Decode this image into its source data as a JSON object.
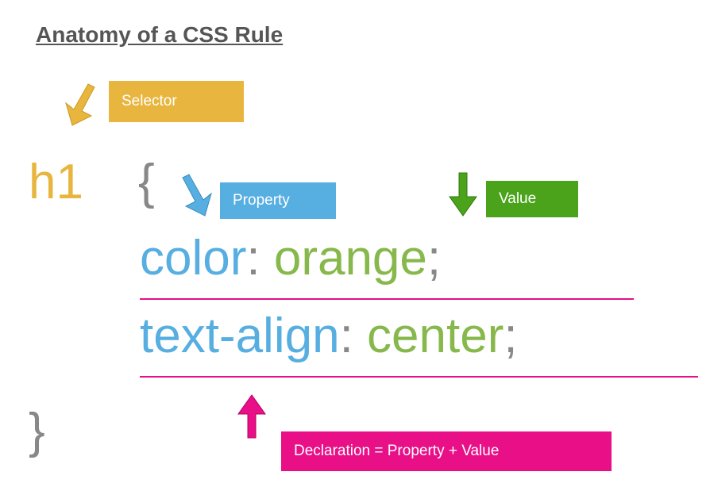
{
  "title": "Anatomy of a CSS Rule",
  "labels": {
    "selector": "Selector",
    "property": "Property",
    "value": "Value",
    "declaration": "Declaration = Property + Value"
  },
  "code": {
    "selector": "h1",
    "brace_open": "{",
    "brace_close": "}",
    "line1_property": "color",
    "line1_colon": ": ",
    "line1_value": "orange",
    "line1_semi": ";",
    "line2_property": "text-align",
    "line2_colon": ": ",
    "line2_value": "center",
    "line2_semi": ";"
  },
  "colors": {
    "selector_box": "#e8b63f",
    "property_box": "#57aee1",
    "value_box": "#4aa31a",
    "declaration_box": "#e80f87",
    "prop_text": "#57aee1",
    "val_text": "#87b84b",
    "punct_text": "#888"
  }
}
